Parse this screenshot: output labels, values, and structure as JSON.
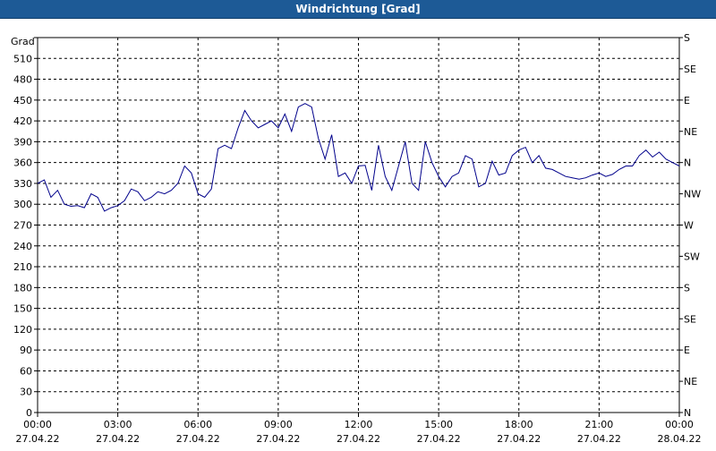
{
  "window": {
    "title": "Windrichtung [Grad]"
  },
  "chart_data": {
    "type": "line",
    "title": "Windrichtung [Grad]",
    "ylabel": "Grad",
    "ylim": [
      0,
      540
    ],
    "yticks": [
      0,
      30,
      60,
      90,
      120,
      150,
      180,
      210,
      240,
      270,
      300,
      330,
      360,
      390,
      420,
      450,
      480,
      510
    ],
    "xlim": [
      0,
      24
    ],
    "xticks": [
      {
        "time": "00:00",
        "date": "27.04.22"
      },
      {
        "time": "03:00",
        "date": "27.04.22"
      },
      {
        "time": "06:00",
        "date": "27.04.22"
      },
      {
        "time": "09:00",
        "date": "27.04.22"
      },
      {
        "time": "12:00",
        "date": "27.04.22"
      },
      {
        "time": "15:00",
        "date": "27.04.22"
      },
      {
        "time": "18:00",
        "date": "27.04.22"
      },
      {
        "time": "21:00",
        "date": "27.04.22"
      },
      {
        "time": "00:00",
        "date": "28.04.22"
      }
    ],
    "right_axis_labels": [
      "N",
      "NE",
      "E",
      "SE",
      "S",
      "SW",
      "W",
      "NW",
      "N",
      "NE",
      "E",
      "SE",
      "S"
    ],
    "grid": true,
    "line_color": "#00008b",
    "series": [
      {
        "x": [
          0,
          0.25,
          0.5,
          0.75,
          1.0,
          1.25,
          1.5,
          1.75,
          2.0,
          2.25,
          2.5,
          2.75,
          3.0,
          3.25,
          3.5,
          3.75,
          4.0,
          4.25,
          4.5,
          4.75,
          5.0,
          5.25,
          5.5,
          5.75,
          6.0,
          6.25,
          6.5,
          6.75,
          7.0,
          7.25,
          7.5,
          7.75,
          8.0,
          8.25,
          8.5,
          8.75,
          9.0,
          9.25,
          9.5,
          9.75,
          10.0,
          10.25,
          10.5,
          10.75,
          11.0,
          11.25,
          11.5,
          11.75,
          12.0,
          12.25,
          12.5,
          12.75,
          13.0,
          13.25,
          13.5,
          13.75,
          14.0,
          14.25,
          14.5,
          14.75,
          15.0,
          15.25,
          15.5,
          15.75,
          16.0,
          16.25,
          16.5,
          16.75,
          17.0,
          17.25,
          17.5,
          17.75,
          18.0,
          18.25,
          18.5,
          18.75,
          19.0,
          19.25,
          19.5,
          19.75,
          20.0,
          20.25,
          20.5,
          20.75,
          21.0,
          21.25,
          21.5,
          21.75,
          22.0,
          22.25,
          22.5,
          22.75,
          23.0,
          23.25,
          23.5,
          23.75,
          24.0
        ],
        "values": [
          330,
          335,
          310,
          320,
          300,
          297,
          298,
          295,
          315,
          310,
          290,
          295,
          298,
          305,
          322,
          318,
          305,
          310,
          318,
          315,
          320,
          330,
          355,
          345,
          315,
          310,
          322,
          380,
          385,
          380,
          410,
          435,
          420,
          410,
          415,
          420,
          410,
          430,
          405,
          440,
          445,
          440,
          395,
          365,
          400,
          340,
          345,
          330,
          355,
          356,
          320,
          385,
          340,
          320,
          355,
          390,
          330,
          320,
          390,
          360,
          340,
          325,
          340,
          345,
          370,
          365,
          325,
          330,
          362,
          342,
          345,
          370,
          378,
          382,
          360,
          370,
          352,
          350,
          345,
          340,
          338,
          336,
          338,
          342,
          345,
          340,
          343,
          350,
          355,
          355,
          370,
          378,
          368,
          375,
          365,
          360,
          355
        ]
      }
    ]
  }
}
